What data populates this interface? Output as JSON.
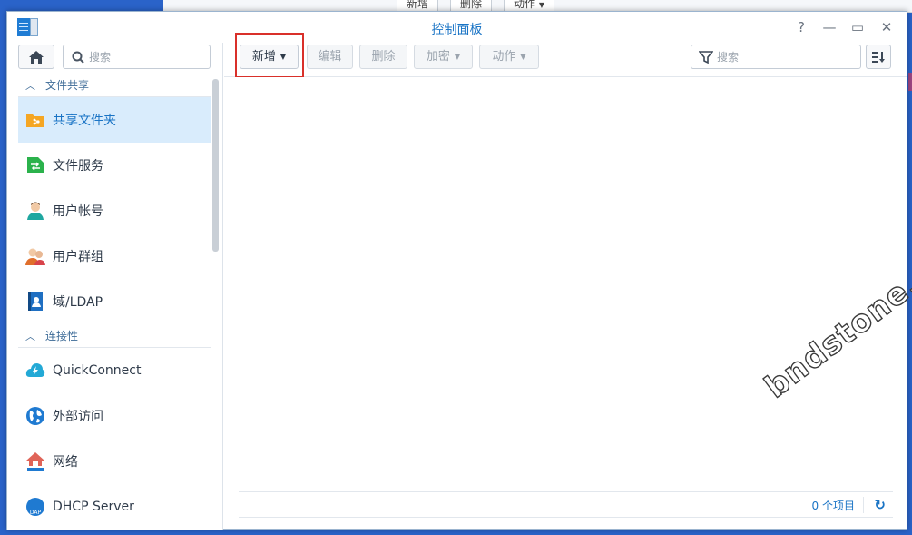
{
  "background_window": {
    "buttons": [
      "新增",
      "删除",
      "动作"
    ]
  },
  "window": {
    "title": "控制面板",
    "controls": [
      "?",
      "—",
      "▭",
      "✕"
    ]
  },
  "sidebar": {
    "search_placeholder": "搜索",
    "groups": [
      {
        "label": "文件共享",
        "items": [
          {
            "label": "共享文件夹",
            "icon": "shared-folder-icon",
            "active": true
          },
          {
            "label": "文件服务",
            "icon": "file-services-icon"
          },
          {
            "label": "用户帐号",
            "icon": "user-icon"
          },
          {
            "label": "用户群组",
            "icon": "group-icon"
          },
          {
            "label": "域/LDAP",
            "icon": "ldap-icon"
          }
        ]
      },
      {
        "label": "连接性",
        "items": [
          {
            "label": "QuickConnect",
            "icon": "quickconnect-icon"
          },
          {
            "label": "外部访问",
            "icon": "globe-icon"
          },
          {
            "label": "网络",
            "icon": "network-icon"
          },
          {
            "label": "DHCP Server",
            "icon": "dhcp-icon"
          }
        ]
      }
    ]
  },
  "toolbar": {
    "create_label": "新增",
    "edit_label": "编辑",
    "delete_label": "删除",
    "encrypt_label": "加密",
    "action_label": "动作",
    "filter_placeholder": "搜索"
  },
  "watermark": "bndstone.com",
  "status": {
    "item_count": "0 个项目"
  },
  "colors": {
    "accent": "#1a74c5",
    "active_bg": "#d9ecfc",
    "highlight": "#d9302a"
  }
}
